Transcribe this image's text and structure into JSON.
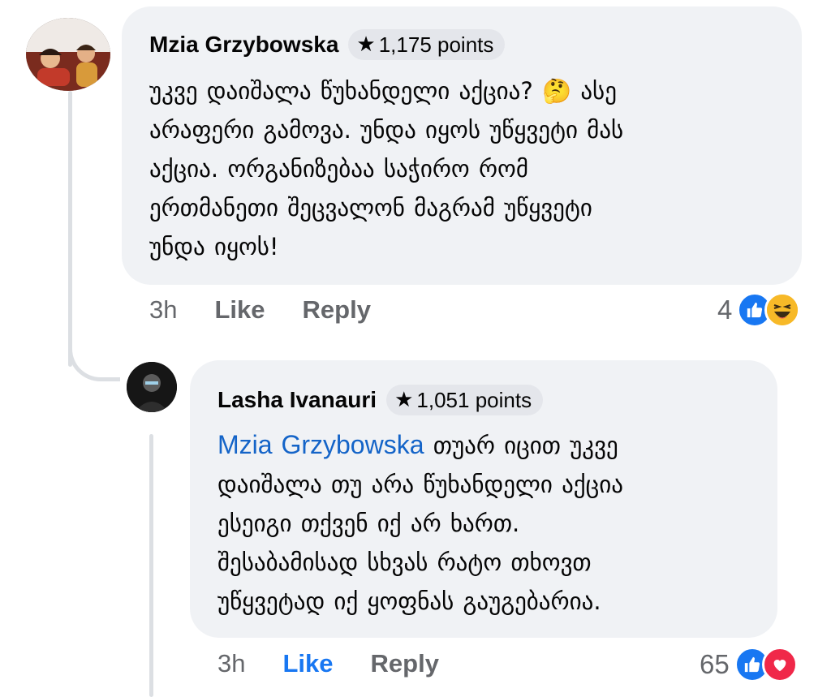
{
  "comments": [
    {
      "author": "Mzia Grzybowska",
      "points": "1,175 points",
      "text_lines": [
        "უკვე დაიშალა წუხანდელი აქცია? 🤔 ასე",
        "არაფერი გამოვა. უნდა იყოს უწყვეტი მას",
        "აქცია. ორგანიზებაა საჭირო  რომ",
        "ერთმანეთი შეცვალონ   მაგრამ უწყვეტი",
        "უნდა იყოს!"
      ],
      "time": "3h",
      "like_label": "Like",
      "reply_label": "Reply",
      "reaction_count": "4",
      "reactions": [
        "like-icon",
        "haha-icon"
      ]
    },
    {
      "author": "Lasha Ivanauri",
      "points": "1,051 points",
      "mention": "Mzia Grzybowska",
      "text_lines": [
        "თუარ იცით უკვე",
        "დაიშალა თუ არა წუხანდელი აქცია",
        "ესეიგი თქვენ იქ არ ხართ.",
        "შესაბამისად სხვას რატო თხოვთ",
        "უწყვეტად იქ ყოფნას გაუგებარია."
      ],
      "time": "3h",
      "like_label": "Like",
      "like_active": true,
      "reply_label": "Reply",
      "reaction_count": "65",
      "reactions": [
        "like-icon",
        "love-icon"
      ]
    }
  ],
  "colors": {
    "bubble": "#f0f2f5",
    "badge": "#e4e6eb",
    "like_active": "#1877f2",
    "meta": "#65676b",
    "mention": "#1464c8",
    "thread_line": "#dcdfe3"
  }
}
